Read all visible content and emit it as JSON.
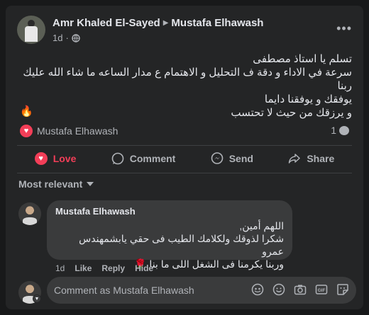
{
  "post": {
    "author": "Amr Khaled El-Sayed",
    "recipient": "Mustafa Elhawash",
    "time": "1d",
    "text_lines": [
      "تسلم يا استاذ مصطفى",
      "سرعة في الاداء و دقة ف التحليل و الاهتمام ع مدار الساعه ما شاء الله عليك ربنا",
      "يوفقك و يوفقنا دايما",
      "و يرزقك من حيث لا تحتسب"
    ],
    "emoji": "🔥"
  },
  "reactions": {
    "by": "Mustafa Elhawash",
    "comment_count": "1"
  },
  "actions": {
    "love": "Love",
    "comment": "Comment",
    "send": "Send",
    "share": "Share"
  },
  "sort": {
    "label": "Most relevant"
  },
  "comment": {
    "author": "Mustafa Elhawash",
    "lines": [
      "اللهم أمين,",
      "شكرا لذوقك ولكلامك الطيب فى حقي يابشمهندس عمرو",
      "وربنا يكرمنا فى الشغل اللى ما بنا 🌹"
    ],
    "time": "1d",
    "like": "Like",
    "reply": "Reply",
    "hide": "Hide"
  },
  "composer": {
    "placeholder": "Comment as Mustafa Elhawash"
  },
  "colors": {
    "background": "#18191a",
    "card": "#242526",
    "bubble": "#3a3b3c",
    "love": "#f33e58",
    "text": "#e4e6eb",
    "muted": "#b0b3b8"
  }
}
